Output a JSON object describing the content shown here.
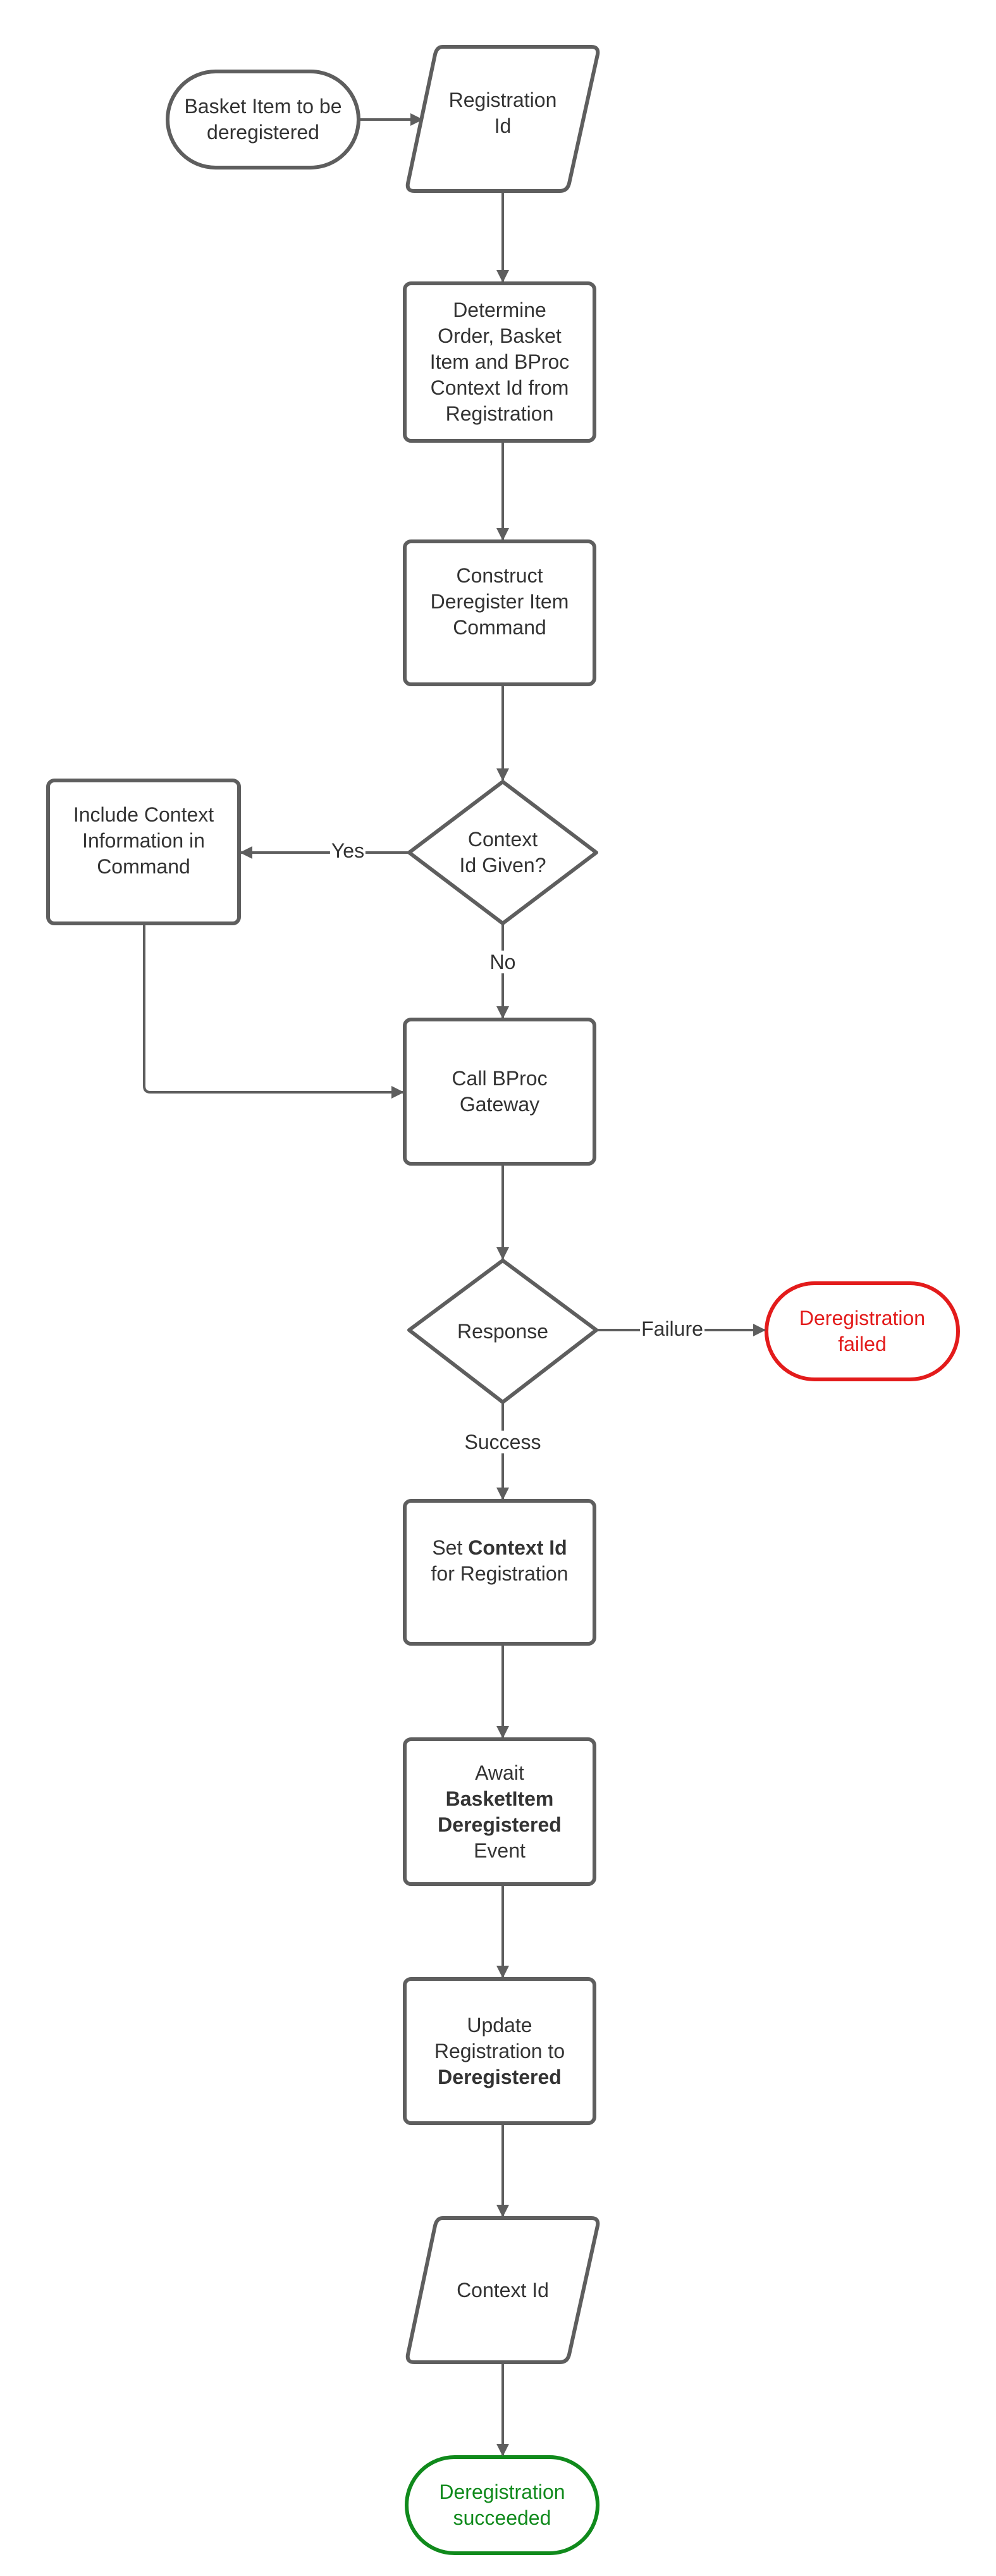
{
  "diagram": {
    "type": "flowchart",
    "colors": {
      "stroke": "#5e5e5e",
      "text": "#333333",
      "failure": "#e31b1b",
      "success": "#108a1c"
    },
    "nodes": {
      "start": {
        "kind": "terminator",
        "lines": [
          "Basket Item to be",
          "deregistered"
        ]
      },
      "registration_id": {
        "kind": "input-output",
        "lines": [
          "Registration",
          "Id"
        ]
      },
      "determine": {
        "kind": "process",
        "lines": [
          "Determine",
          "Order, Basket",
          "Item and BProc",
          "Context Id from",
          "Registration"
        ]
      },
      "construct": {
        "kind": "process",
        "lines": [
          "Construct",
          "Deregister Item",
          "Command"
        ]
      },
      "context_given": {
        "kind": "decision",
        "lines": [
          "Context",
          "Id Given?"
        ]
      },
      "include_context": {
        "kind": "process",
        "lines": [
          "Include Context",
          "Information in",
          "Command"
        ]
      },
      "call_gateway": {
        "kind": "process",
        "lines": [
          "Call BProc",
          "Gateway"
        ]
      },
      "response": {
        "kind": "decision",
        "lines": [
          "Response"
        ]
      },
      "failed": {
        "kind": "terminator",
        "status": "failure",
        "lines": [
          "Deregistration",
          "failed"
        ]
      },
      "set_context": {
        "kind": "process",
        "prefix": "Set ",
        "bold": "Context Id",
        "suffix_line": "for Registration"
      },
      "await_event": {
        "kind": "process",
        "line1": "Await",
        "bold1": "BasketItem",
        "bold2": "Deregistered",
        "line4": "Event"
      },
      "update_registration": {
        "kind": "process",
        "line1": "Update",
        "line2": "Registration to",
        "bold": "Deregistered"
      },
      "context_id": {
        "kind": "input-output",
        "lines": [
          "Context Id"
        ]
      },
      "succeeded": {
        "kind": "terminator",
        "status": "success",
        "lines": [
          "Deregistration",
          "succeeded"
        ]
      }
    },
    "edges": [
      {
        "from": "start",
        "to": "registration_id",
        "label": ""
      },
      {
        "from": "registration_id",
        "to": "determine",
        "label": ""
      },
      {
        "from": "determine",
        "to": "construct",
        "label": ""
      },
      {
        "from": "construct",
        "to": "context_given",
        "label": ""
      },
      {
        "from": "context_given",
        "to": "include_context",
        "label": "Yes"
      },
      {
        "from": "context_given",
        "to": "call_gateway",
        "label": "No"
      },
      {
        "from": "include_context",
        "to": "call_gateway",
        "label": ""
      },
      {
        "from": "call_gateway",
        "to": "response",
        "label": ""
      },
      {
        "from": "response",
        "to": "failed",
        "label": "Failure"
      },
      {
        "from": "response",
        "to": "set_context",
        "label": "Success"
      },
      {
        "from": "set_context",
        "to": "await_event",
        "label": ""
      },
      {
        "from": "await_event",
        "to": "update_registration",
        "label": ""
      },
      {
        "from": "update_registration",
        "to": "context_id",
        "label": ""
      },
      {
        "from": "context_id",
        "to": "succeeded",
        "label": ""
      }
    ]
  }
}
